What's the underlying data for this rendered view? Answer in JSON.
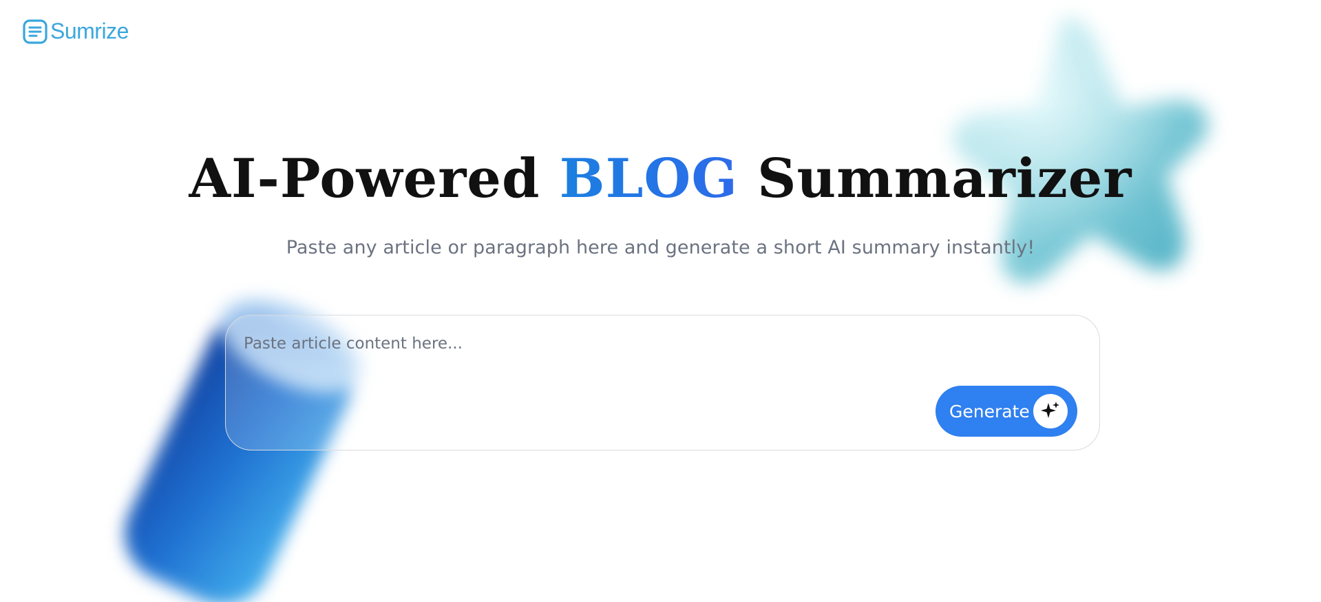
{
  "header": {
    "brand_name": "Sumrize",
    "logo_icon": "document-lines-icon",
    "brand_color": "#3aa6dc"
  },
  "hero": {
    "title_prefix": "AI-Powered ",
    "title_accent": "BLOG",
    "title_suffix": " Summarizer",
    "accent_color": "#1a73e8",
    "subtitle": "Paste any article or paragraph here and generate a short AI summary instantly!"
  },
  "input_card": {
    "placeholder": "Paste article content here...",
    "value": "",
    "generate_label": "Generate",
    "generate_icon": "sparkle-icon",
    "button_color": "#2f80f0"
  },
  "decorations": {
    "star_icon": "star-3d-shape",
    "cylinder_icon": "cylinder-3d-shape"
  }
}
